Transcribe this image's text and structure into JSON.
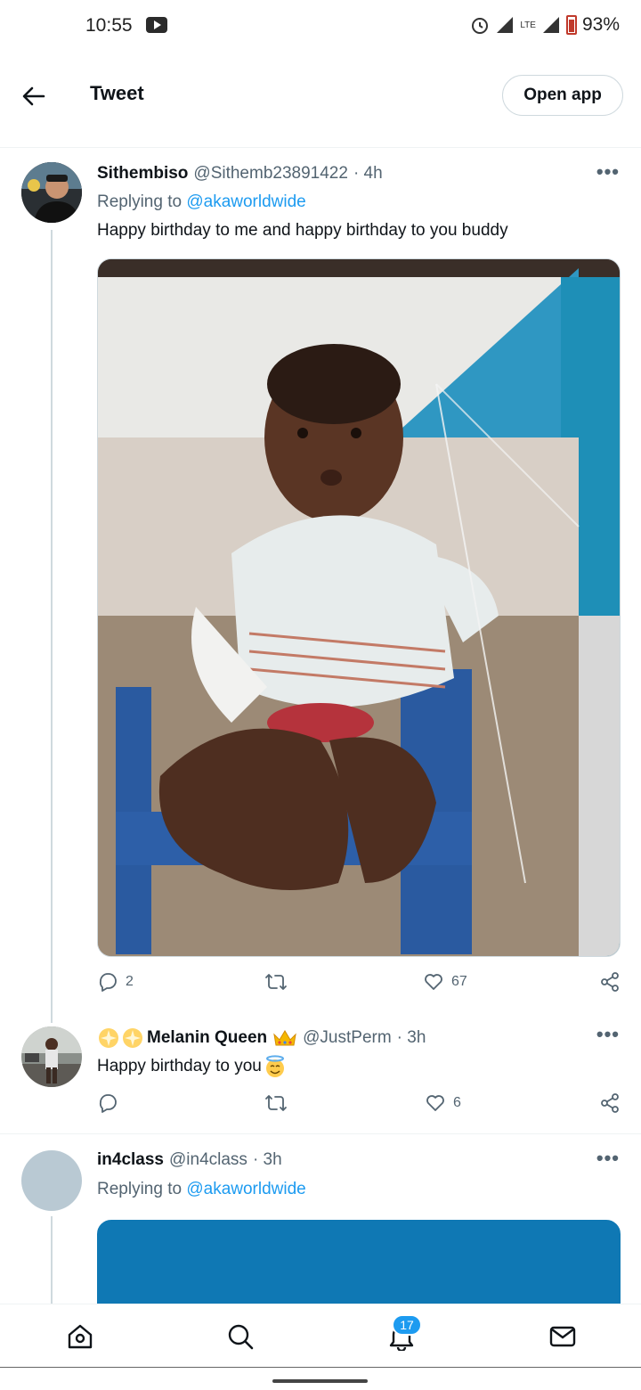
{
  "status_bar": {
    "time": "10:55",
    "network": "LTE",
    "battery": "93%"
  },
  "header": {
    "title": "Tweet",
    "open_app": "Open app"
  },
  "tweets": [
    {
      "name": "Sithembiso",
      "handle": "@Sithemb23891422",
      "time": "· 4h",
      "replying_prefix": "Replying to ",
      "replying_to": "@akaworldwide",
      "text": "Happy birthday to me and happy birthday to you buddy",
      "reply_count": "2",
      "retweet_count": "",
      "like_count": "67"
    },
    {
      "name": "Melanin Queen",
      "handle": "@JustPerm",
      "time": "· 3h",
      "text": "Happy birthday to you",
      "reply_count": "",
      "retweet_count": "",
      "like_count": "6"
    },
    {
      "name": "in4class",
      "handle": "@in4class",
      "time": "· 3h",
      "replying_prefix": "Replying to ",
      "replying_to": "@akaworldwide"
    }
  ],
  "bottom_nav": {
    "notifications_badge": "17",
    "items": [
      "home-icon",
      "search-icon",
      "bell-icon",
      "mail-icon"
    ]
  },
  "colors": {
    "accent": "#1d9bf0",
    "secondary_text": "#536471",
    "border": "#cfd9de"
  }
}
